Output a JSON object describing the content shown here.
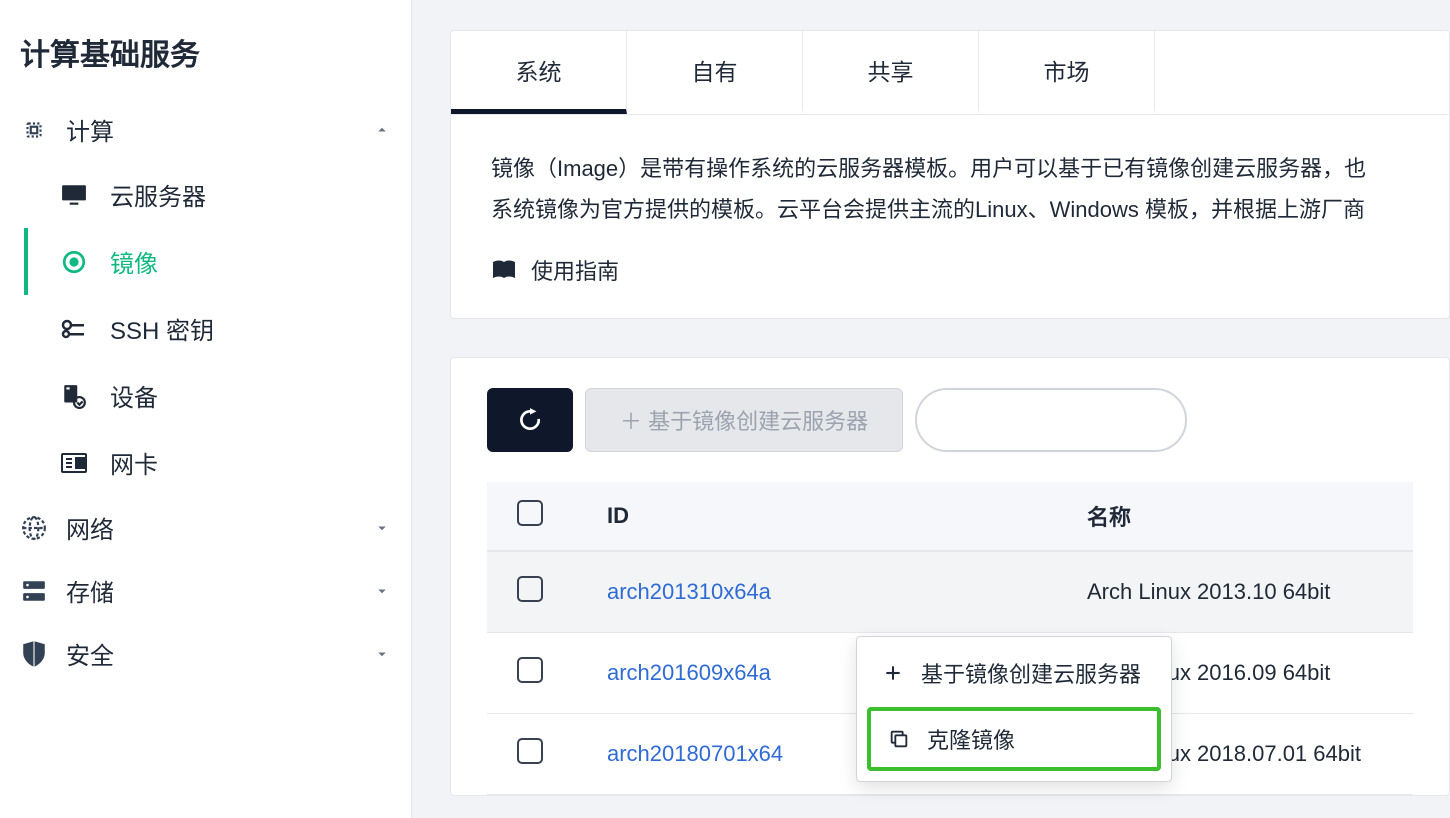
{
  "sidebar": {
    "title": "计算基础服务",
    "groups": [
      {
        "label": "计算",
        "icon": "cpu-icon",
        "expanded": true,
        "subs": [
          {
            "label": "云服务器",
            "icon": "monitor-icon"
          },
          {
            "label": "镜像",
            "icon": "disc-icon",
            "active": true
          },
          {
            "label": "SSH 密钥",
            "icon": "key-icon"
          },
          {
            "label": "设备",
            "icon": "device-icon"
          },
          {
            "label": "网卡",
            "icon": "nic-icon"
          }
        ]
      },
      {
        "label": "网络",
        "icon": "globe-icon",
        "expanded": false
      },
      {
        "label": "存储",
        "icon": "storage-icon",
        "expanded": false
      },
      {
        "label": "安全",
        "icon": "shield-icon",
        "expanded": false
      }
    ]
  },
  "tabs": [
    {
      "label": "系统",
      "active": true
    },
    {
      "label": "自有",
      "active": false
    },
    {
      "label": "共享",
      "active": false
    },
    {
      "label": "市场",
      "active": false
    }
  ],
  "desc_line1": "镜像（Image）是带有操作系统的云服务器模板。用户可以基于已有镜像创建云服务器，也",
  "desc_line2": "系统镜像为官方提供的模板。云平台会提供主流的Linux、Windows 模板，并根据上游厂商",
  "guide_label": "使用指南",
  "toolbar": {
    "create_label": "＋  基于镜像创建云服务器"
  },
  "table": {
    "headers": {
      "id": "ID",
      "name": "名称"
    },
    "rows": [
      {
        "id": "arch201310x64a",
        "name": "Arch Linux 2013.10 64bit",
        "highlight": true
      },
      {
        "id": "arch201609x64a",
        "name": "Arch Linux 2016.09 64bit",
        "highlight": false
      },
      {
        "id": "arch20180701x64",
        "name": "Arch Linux 2018.07.01 64bit",
        "highlight": false
      }
    ]
  },
  "context_menu": [
    {
      "label": "基于镜像创建云服务器",
      "icon": "plus-icon",
      "boxed": false
    },
    {
      "label": "克隆镜像",
      "icon": "copy-icon",
      "boxed": true
    }
  ]
}
